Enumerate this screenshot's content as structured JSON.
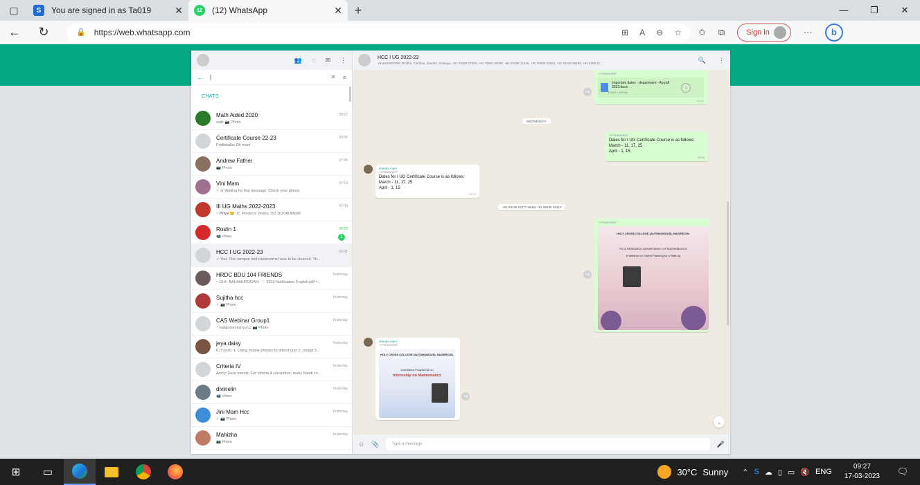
{
  "browser": {
    "tabs": [
      {
        "title": "You are signed in as Ta019",
        "favicon_letter": "S",
        "favicon_color": "#1e6bd6"
      },
      {
        "title": "(12) WhatsApp",
        "favicon_letter": "12",
        "favicon_color": "#25d366"
      }
    ],
    "url": "https://web.whatsapp.com",
    "signin_label": "Sign in"
  },
  "sidebar": {
    "search_value": "|",
    "chats_label": "CHATS",
    "chats": [
      {
        "name": "Math Aided 2020",
        "preview": "sujit: 📷 Photo",
        "time": "09:07",
        "color": "#2a7a2a"
      },
      {
        "name": "Certificate Course 22-23",
        "preview": "Prathwalia: Ok mam",
        "time": "09:06",
        "color": "#d3d6d9"
      },
      {
        "name": "Andrew Father",
        "preview": "📷 Photo",
        "time": "07:46",
        "color": "#8a7060"
      },
      {
        "name": "Vini Mam",
        "preview": "✓ ⊘ Waiting for this message. Check your phone.",
        "time": "07:13",
        "color": "#a07090"
      },
      {
        "name": "III UG Maths 2022-2023",
        "preview": "~ 𝐏𝐫𝐢𝐲𝐚 😊: D. Florance Veena: OD 2020AUM098",
        "time": "07:00",
        "color": "#c0392b"
      },
      {
        "name": "Roslin 1",
        "preview": "📹 Video",
        "time": "06:23",
        "color": "#d62828",
        "unread": "1"
      },
      {
        "name": "HCC I UG 2022-23",
        "preview": "✓ You: The campus and classrooms have to be cleaned. Th...",
        "time": "00:41",
        "color": "#d3d6d9",
        "selected": true
      },
      {
        "name": "HRDC BDU 104 FRIENDS",
        "preview": "~ Dr.K. BALAMURUGAN: 📄 2023 Notification  English.pdf •...",
        "time": "Yesterday",
        "color": "#6b5a5a"
      },
      {
        "name": "Sujitha hcc",
        "preview": "✓ 📷 Photo",
        "time": "Yesterday",
        "color": "#b03a3a"
      },
      {
        "name": "CAS  Webinar Group1",
        "preview": "~ balajichemistryvcu: 📷 Photo",
        "time": "Yesterday",
        "color": "#d3d6d9"
      },
      {
        "name": "jeya daisy",
        "preview": "ICT tools: 1. Using mobile phones to attend quiz 2. Usage 5...",
        "time": "Yesterday",
        "color": "#7a5544"
      },
      {
        "name": "Criteria IV",
        "preview": "Amcy: Dear friends, For criteria 4 consortion, many Naviti co...",
        "time": "Yesterday",
        "color": "#d3d6d9"
      },
      {
        "name": "divinelin",
        "preview": "📹 Video",
        "time": "Yesterday",
        "color": "#6a7c8a"
      },
      {
        "name": "Jini Mam Hcc",
        "preview": "✓ 📷 Photo",
        "time": "Yesterday",
        "color": "#3a8fd8"
      },
      {
        "name": "Mahizha",
        "preview": "📷 Photo",
        "time": "Yesterday",
        "color": "#c07a66"
      }
    ]
  },
  "conversation": {
    "group_name": "HCC I UG 2022-23",
    "members": "+919444807996, Bindha, Caroline, sheeba, Sowmya, +91 93458 07556, +91 79982 80065, +91 84286 12106, +91 94895 63324, +91 93442 95196, +91 6385 52...",
    "day_label": "WEDNESDAY",
    "forwarded": "Forwarded",
    "doc": {
      "name": "Important dates - department - Ap.pdf 2023.docx",
      "size": "DOCX • 200 kB",
      "time": "09:21"
    },
    "msg_out_text": "Dates for I UG Certificate Course is as follows:\nMarch - 11, 17, 25\nApril - 1, 15",
    "msg_out_time": "08:58",
    "sender": "sheeba mam",
    "msg_in_text": "Dates for I UG Certificate Course is as follows:\nMarch - 11, 17, 25\nApril - 1, 15",
    "msg_in_time": "09:21",
    "sys_added": "+91 93446 57577 added +91 99436 26212",
    "poster1": {
      "title": "HOLY CROSS COLLEGE (AUTONOMOUS), NAGERCOIL",
      "dept": "PG & RESEARCH DEPARTMENT OF MATHEMATICS",
      "topic": "A Webinar on Career Planning for a Start-up"
    },
    "poster2": {
      "title": "HOLY CROSS COLLEGE (AUTONOMOUS), NAGERCOIL",
      "line": "Orientation Programme on",
      "headline": "Internship on Mathematics"
    },
    "composer_placeholder": "Type a message"
  },
  "taskbar": {
    "temp": "30°C",
    "weather": "Sunny",
    "lang": "ENG",
    "time": "09:27",
    "date": "17-03-2023"
  }
}
